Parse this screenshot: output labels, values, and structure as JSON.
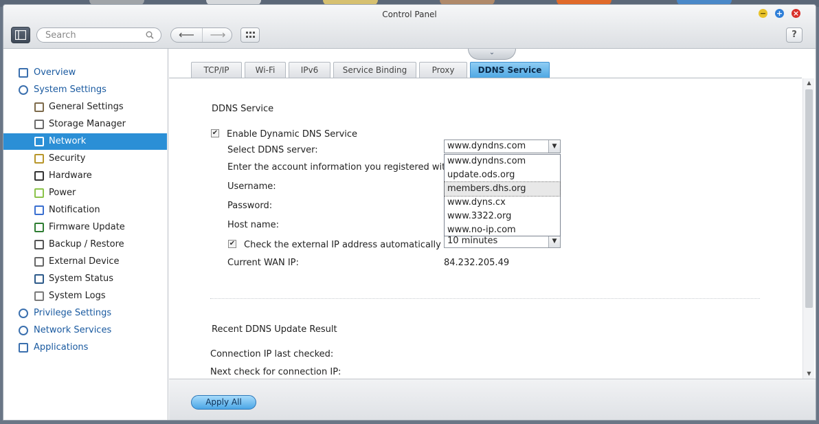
{
  "window": {
    "title": "Control Panel",
    "controls": {
      "minimize": "−",
      "maximize": "+",
      "close": "×"
    }
  },
  "toolbar": {
    "search_placeholder": "Search",
    "back_arrow": "⟵",
    "forward_arrow": "⟶",
    "help_label": "?"
  },
  "sidebar": {
    "items": [
      {
        "label": "Overview",
        "level": "top",
        "icon": "overview-icon"
      },
      {
        "label": "System Settings",
        "level": "top",
        "icon": "gear-icon"
      },
      {
        "label": "General Settings",
        "level": "sub",
        "icon": "general-settings-icon"
      },
      {
        "label": "Storage Manager",
        "level": "sub",
        "icon": "storage-icon"
      },
      {
        "label": "Network",
        "level": "sub",
        "icon": "network-icon",
        "selected": true
      },
      {
        "label": "Security",
        "level": "sub",
        "icon": "lock-icon"
      },
      {
        "label": "Hardware",
        "level": "sub",
        "icon": "hardware-icon"
      },
      {
        "label": "Power",
        "level": "sub",
        "icon": "power-bulb-icon"
      },
      {
        "label": "Notification",
        "level": "sub",
        "icon": "notification-icon"
      },
      {
        "label": "Firmware Update",
        "level": "sub",
        "icon": "firmware-icon"
      },
      {
        "label": "Backup / Restore",
        "level": "sub",
        "icon": "backup-icon"
      },
      {
        "label": "External Device",
        "level": "sub",
        "icon": "external-device-icon"
      },
      {
        "label": "System Status",
        "level": "sub",
        "icon": "monitor-icon"
      },
      {
        "label": "System Logs",
        "level": "sub",
        "icon": "logs-icon"
      },
      {
        "label": "Privilege Settings",
        "level": "top",
        "icon": "user-icon"
      },
      {
        "label": "Network Services",
        "level": "top",
        "icon": "globe-icon"
      },
      {
        "label": "Applications",
        "level": "top",
        "icon": "applications-icon"
      }
    ]
  },
  "tabs": [
    {
      "label": "TCP/IP"
    },
    {
      "label": "Wi-Fi"
    },
    {
      "label": "IPv6"
    },
    {
      "label": "Service Binding"
    },
    {
      "label": "Proxy"
    },
    {
      "label": "DDNS Service",
      "active": true
    }
  ],
  "ddns": {
    "heading": "DDNS Service",
    "enable_label": "Enable Dynamic DNS Service",
    "enable_checked": true,
    "server_label": "Select DDNS server:",
    "server_value": "www.dyndns.com",
    "account_info_label": "Enter the account information you registered with",
    "username_label": "Username:",
    "password_label": "Password:",
    "hostname_label": "Host name:",
    "check_ip_label": "Check the external IP address automatically",
    "check_ip_checked": true,
    "check_interval_value": "10 minutes",
    "wan_ip_label": "Current WAN IP:",
    "wan_ip_value": "84.232.205.49",
    "server_options": [
      "www.dyndns.com",
      "update.ods.org",
      "members.dhs.org",
      "www.dyns.cx",
      "www.3322.org",
      "www.no-ip.com"
    ],
    "hovered_option": "members.dhs.org"
  },
  "recent": {
    "heading": "Recent DDNS Update Result",
    "last_checked_label": "Connection IP last checked:",
    "next_check_label": "Next check for connection IP:"
  },
  "footer": {
    "apply_label": "Apply All"
  },
  "colors": {
    "selected_item": "#2b8fd6",
    "top_level_link": "#1a5aa0",
    "active_tab": "#4fa8e3"
  }
}
